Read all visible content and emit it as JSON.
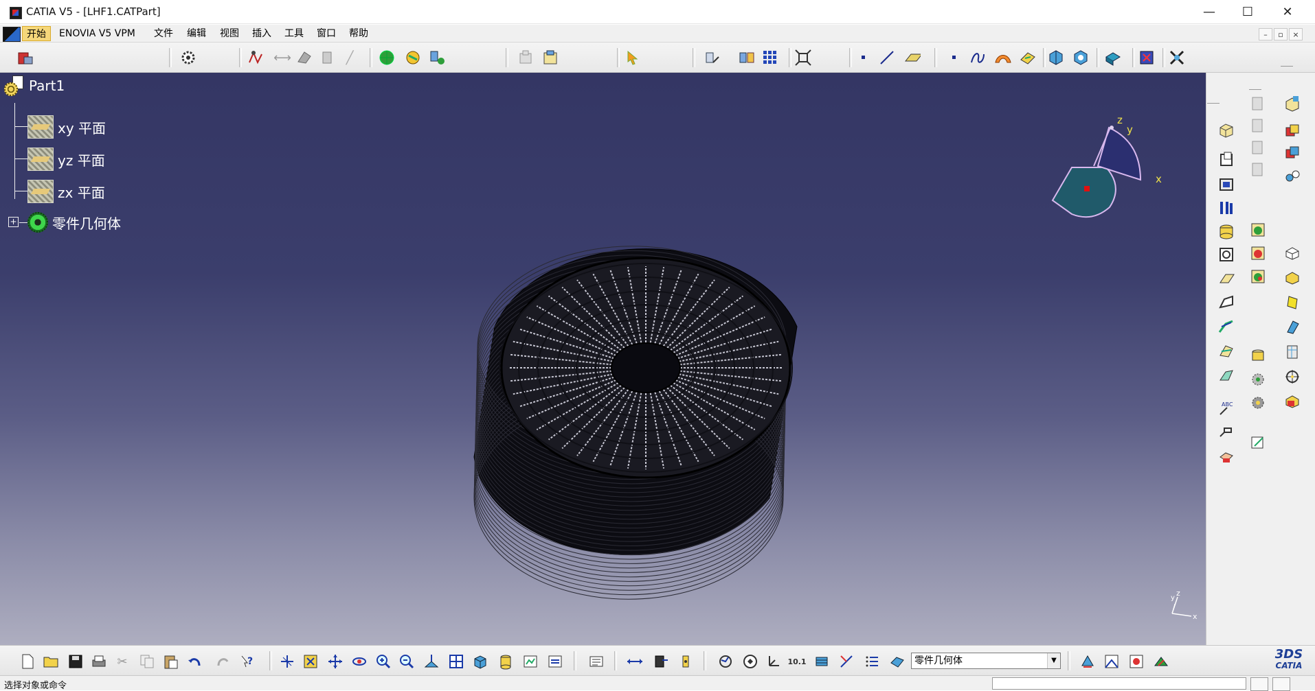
{
  "window": {
    "title": "CATIA V5 - [LHF1.CATPart]",
    "minimize": "—",
    "maximize": "☐",
    "close": "✕"
  },
  "menu": {
    "items": [
      "开始",
      "ENOVIA V5 VPM",
      "文件",
      "编辑",
      "视图",
      "插入",
      "工具",
      "窗口",
      "帮助"
    ]
  },
  "tree": {
    "root": "Part1",
    "planes": [
      "xy 平面",
      "yz 平面",
      "zx 平面"
    ],
    "body": "零件几何体"
  },
  "compass": {
    "x": "x",
    "y": "y",
    "z": "z"
  },
  "mini_axis": {
    "x": "x",
    "y": "y",
    "z": "z"
  },
  "bottom": {
    "current_body_select": "零件几何体",
    "logo_text": "CATIA",
    "logo_mark": "3DS"
  },
  "status": {
    "prompt": "选择对象或命令"
  }
}
